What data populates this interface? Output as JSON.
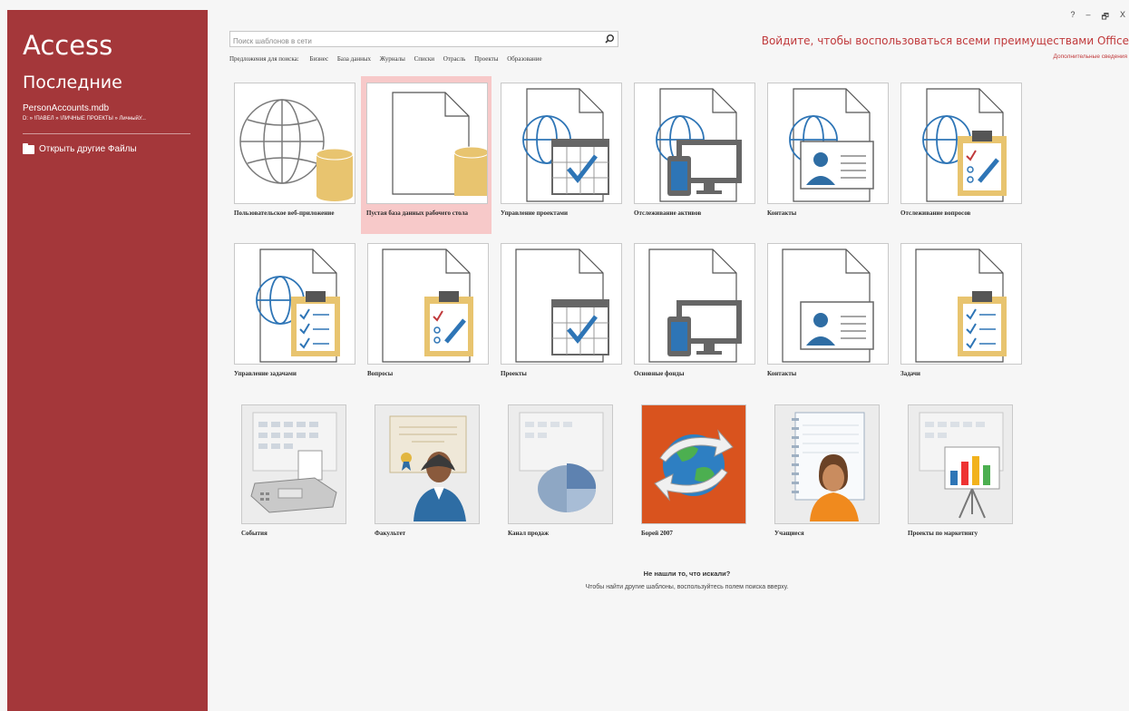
{
  "sidebar": {
    "app_title": "Access",
    "recent_title": "Последние",
    "recent_file_name": "PersonAccounts.mdb",
    "recent_file_path": "D: » !ПАВЕЛ » !ЛИЧНЫЕ ПРОЕКТЫ » ЛичныйУ...",
    "open_other": "Открыть другие Файлы"
  },
  "search": {
    "placeholder": "Поиск шаблонов в сети",
    "suggestions_label": "Предложения для поиска:",
    "suggestions": [
      "Бизнес",
      "База данных",
      "Журналы",
      "Списки",
      "Отрасль",
      "Проекты",
      "Образование"
    ]
  },
  "header": {
    "signin": "Войдите, чтобы воспользоваться всеми преимуществами Office",
    "more_info": "Дополнительные сведения",
    "help": "?",
    "minimize": "–",
    "restore": "🗗",
    "close": "X"
  },
  "templates": [
    {
      "label": "Пользовательское веб-приложение",
      "icon": "globe-database-icon"
    },
    {
      "label": "Пустая база данных рабочего стола",
      "icon": "blank-database-icon",
      "selected": true
    },
    {
      "label": "Управление проектами",
      "icon": "globe-calendar-icon"
    },
    {
      "label": "Отслеживание активов",
      "icon": "globe-devices-icon"
    },
    {
      "label": "Контакты",
      "icon": "globe-contact-card-icon"
    },
    {
      "label": "Отслеживание вопросов",
      "icon": "globe-clipboard-icon"
    },
    {
      "label": "Управление задачами",
      "icon": "globe-checklist-icon"
    },
    {
      "label": "Вопросы",
      "icon": "clipboard-icon"
    },
    {
      "label": "Проекты",
      "icon": "calendar-icon"
    },
    {
      "label": "Основные фонды",
      "icon": "devices-icon"
    },
    {
      "label": "Контакты",
      "icon": "contact-card-icon"
    },
    {
      "label": "Задачи",
      "icon": "checklist-icon"
    },
    {
      "label": "События",
      "icon": "fax-calendar-icon"
    },
    {
      "label": "Факультет",
      "icon": "faculty-icon"
    },
    {
      "label": "Канал продаж",
      "icon": "pie-chart-icon"
    },
    {
      "label": "Борей 2007",
      "icon": "globe-arrows-icon"
    },
    {
      "label": "Учащиеся",
      "icon": "student-icon"
    },
    {
      "label": "Проекты по маркетингу",
      "icon": "marketing-chart-icon"
    }
  ],
  "not_found": {
    "title": "Не нашли то, что искали?",
    "subtitle": "Чтобы найти другие шаблоны, воспользуйтесь полем поиска вверху."
  },
  "colors": {
    "accent": "#a4373a",
    "link": "#c0393b",
    "check_blue": "#2e75b6",
    "db_gold": "#e8c46f",
    "icon_blue": "#2e6da4"
  }
}
